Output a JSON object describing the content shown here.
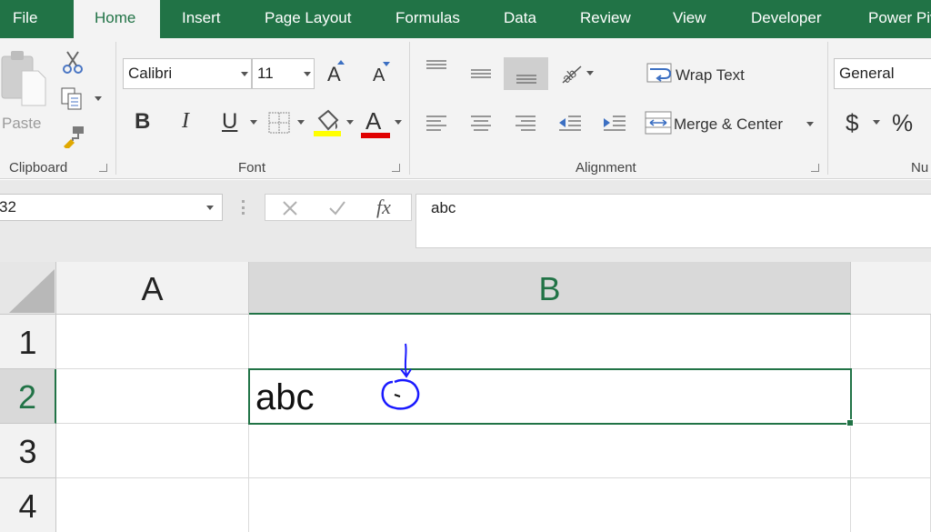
{
  "tabs": [
    {
      "label": "File",
      "active": false
    },
    {
      "label": "Home",
      "active": true
    },
    {
      "label": "Insert",
      "active": false
    },
    {
      "label": "Page Layout",
      "active": false
    },
    {
      "label": "Formulas",
      "active": false
    },
    {
      "label": "Data",
      "active": false
    },
    {
      "label": "Review",
      "active": false
    },
    {
      "label": "View",
      "active": false
    },
    {
      "label": "Developer",
      "active": false
    },
    {
      "label": "Power Piv",
      "active": false
    }
  ],
  "ribbon": {
    "clipboard": {
      "label": "Clipboard",
      "paste_label": "Paste"
    },
    "font": {
      "label": "Font",
      "font_name": "Calibri",
      "font_size": "11",
      "bold": "B",
      "italic": "I",
      "underline": "U",
      "grow": "A",
      "shrink": "A",
      "font_color_glyph": "A"
    },
    "alignment": {
      "label": "Alignment",
      "wrap_text": "Wrap Text",
      "merge_center": "Merge & Center"
    },
    "number": {
      "label": "Nu",
      "format": "General",
      "currency": "$",
      "percent": "%"
    }
  },
  "colors": {
    "brand": "#217346",
    "highlight": "#ffff00",
    "font_color": "#e00000",
    "annotation": "#1a1aff"
  },
  "formula_bar": {
    "name_box": "32",
    "fx": "fx",
    "formula": "abc"
  },
  "grid": {
    "columns": [
      "A",
      "B"
    ],
    "rows": [
      "1",
      "2",
      "3",
      "4"
    ],
    "selected_column": "B",
    "selected_row": "2",
    "active_cell_value": "abc"
  }
}
